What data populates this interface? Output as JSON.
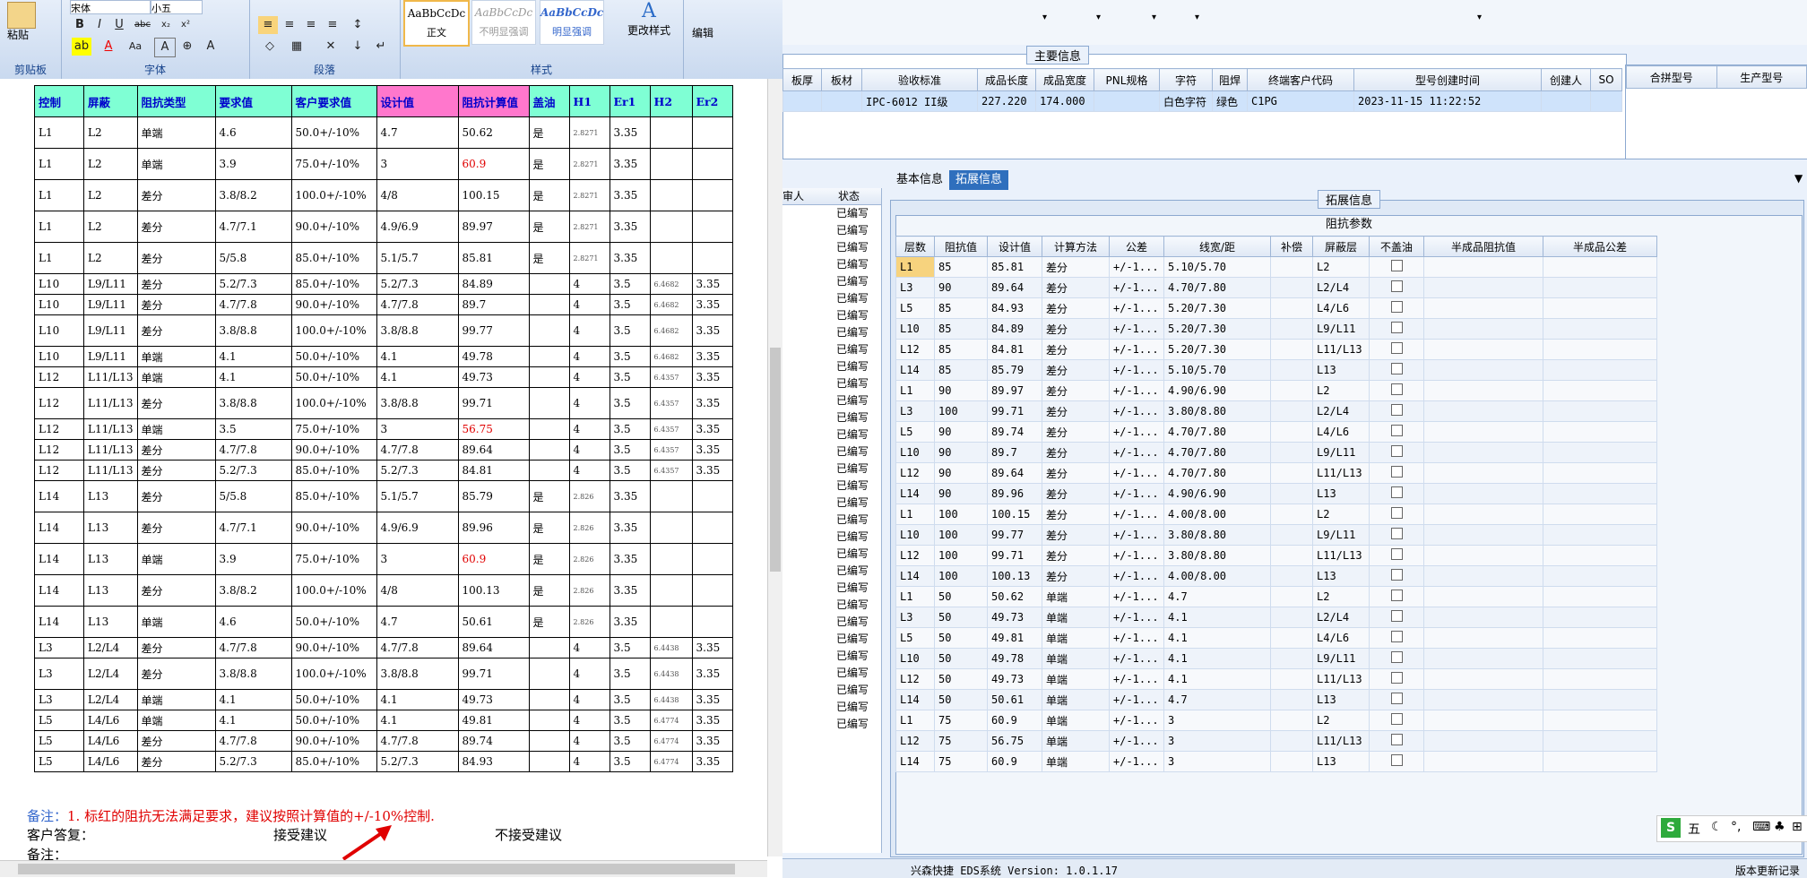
{
  "word": {
    "ribbon": {
      "clipboard": {
        "label": "剪贴板",
        "paste": "粘贴"
      },
      "font": {
        "label": "字体",
        "family": "宋体",
        "size": "小五"
      },
      "paragraph": {
        "label": "段落"
      },
      "styles": {
        "label": "样式",
        "items": [
          "AaBbCcDc",
          "AaBbCcDc",
          "AaBbCcDc"
        ],
        "names": [
          "正文",
          "不明显强调",
          "明显强调"
        ],
        "change": "更改样式"
      },
      "editing": {
        "label": "编辑"
      }
    },
    "table": {
      "headers": [
        "控制",
        "屏蔽",
        "阻抗类型",
        "要求值",
        "客户要求值",
        "设计值",
        "阻抗计算值",
        "盖油",
        "H1",
        "Er1",
        "H2",
        "Er2"
      ],
      "rows": [
        {
          "c": [
            "L1",
            "L2",
            "单端",
            "4.6",
            "50.0+/-10%",
            "4.7",
            "50.62",
            "是",
            "2.8271",
            "3.35",
            "",
            ""
          ],
          "red": false,
          "tall": true
        },
        {
          "c": [
            "L1",
            "L2",
            "单端",
            "3.9",
            "75.0+/-10%",
            "3",
            "60.9",
            "是",
            "2.8271",
            "3.35",
            "",
            ""
          ],
          "red": true,
          "tall": true
        },
        {
          "c": [
            "L1",
            "L2",
            "差分",
            "3.8/8.2",
            "100.0+/-10%",
            "4/8",
            "100.15",
            "是",
            "2.8271",
            "3.35",
            "",
            ""
          ],
          "red": false,
          "tall": true
        },
        {
          "c": [
            "L1",
            "L2",
            "差分",
            "4.7/7.1",
            "90.0+/-10%",
            "4.9/6.9",
            "89.97",
            "是",
            "2.8271",
            "3.35",
            "",
            ""
          ],
          "red": false,
          "tall": true
        },
        {
          "c": [
            "L1",
            "L2",
            "差分",
            "5/5.8",
            "85.0+/-10%",
            "5.1/5.7",
            "85.81",
            "是",
            "2.8271",
            "3.35",
            "",
            ""
          ],
          "red": false,
          "tall": true
        },
        {
          "c": [
            "L10",
            "L9/L11",
            "差分",
            "5.2/7.3",
            "85.0+/-10%",
            "5.2/7.3",
            "84.89",
            "",
            "4",
            "3.5",
            "6.4682",
            "3.35"
          ],
          "red": false,
          "tall": false
        },
        {
          "c": [
            "L10",
            "L9/L11",
            "差分",
            "4.7/7.8",
            "90.0+/-10%",
            "4.7/7.8",
            "89.7",
            "",
            "4",
            "3.5",
            "6.4682",
            "3.35"
          ],
          "red": false,
          "tall": false
        },
        {
          "c": [
            "L10",
            "L9/L11",
            "差分",
            "3.8/8.8",
            "100.0+/-10%",
            "3.8/8.8",
            "99.77",
            "",
            "4",
            "3.5",
            "6.4682",
            "3.35"
          ],
          "red": false,
          "tall": true
        },
        {
          "c": [
            "L10",
            "L9/L11",
            "单端",
            "4.1",
            "50.0+/-10%",
            "4.1",
            "49.78",
            "",
            "4",
            "3.5",
            "6.4682",
            "3.35"
          ],
          "red": false,
          "tall": false
        },
        {
          "c": [
            "L12",
            "L11/L13",
            "单端",
            "4.1",
            "50.0+/-10%",
            "4.1",
            "49.73",
            "",
            "4",
            "3.5",
            "6.4357",
            "3.35"
          ],
          "red": false,
          "tall": false
        },
        {
          "c": [
            "L12",
            "L11/L13",
            "差分",
            "3.8/8.8",
            "100.0+/-10%",
            "3.8/8.8",
            "99.71",
            "",
            "4",
            "3.5",
            "6.4357",
            "3.35"
          ],
          "red": false,
          "tall": true
        },
        {
          "c": [
            "L12",
            "L11/L13",
            "单端",
            "3.5",
            "75.0+/-10%",
            "3",
            "56.75",
            "",
            "4",
            "3.5",
            "6.4357",
            "3.35"
          ],
          "red": true,
          "tall": false
        },
        {
          "c": [
            "L12",
            "L11/L13",
            "差分",
            "4.7/7.8",
            "90.0+/-10%",
            "4.7/7.8",
            "89.64",
            "",
            "4",
            "3.5",
            "6.4357",
            "3.35"
          ],
          "red": false,
          "tall": false
        },
        {
          "c": [
            "L12",
            "L11/L13",
            "差分",
            "5.2/7.3",
            "85.0+/-10%",
            "5.2/7.3",
            "84.81",
            "",
            "4",
            "3.5",
            "6.4357",
            "3.35"
          ],
          "red": false,
          "tall": false
        },
        {
          "c": [
            "L14",
            "L13",
            "差分",
            "5/5.8",
            "85.0+/-10%",
            "5.1/5.7",
            "85.79",
            "是",
            "2.826",
            "3.35",
            "",
            ""
          ],
          "red": false,
          "tall": true
        },
        {
          "c": [
            "L14",
            "L13",
            "差分",
            "4.7/7.1",
            "90.0+/-10%",
            "4.9/6.9",
            "89.96",
            "是",
            "2.826",
            "3.35",
            "",
            ""
          ],
          "red": false,
          "tall": true
        },
        {
          "c": [
            "L14",
            "L13",
            "单端",
            "3.9",
            "75.0+/-10%",
            "3",
            "60.9",
            "是",
            "2.826",
            "3.35",
            "",
            ""
          ],
          "red": true,
          "tall": true
        },
        {
          "c": [
            "L14",
            "L13",
            "差分",
            "3.8/8.2",
            "100.0+/-10%",
            "4/8",
            "100.13",
            "是",
            "2.826",
            "3.35",
            "",
            ""
          ],
          "red": false,
          "tall": true
        },
        {
          "c": [
            "L14",
            "L13",
            "单端",
            "4.6",
            "50.0+/-10%",
            "4.7",
            "50.61",
            "是",
            "2.826",
            "3.35",
            "",
            ""
          ],
          "red": false,
          "tall": true
        },
        {
          "c": [
            "L3",
            "L2/L4",
            "差分",
            "4.7/7.8",
            "90.0+/-10%",
            "4.7/7.8",
            "89.64",
            "",
            "4",
            "3.5",
            "6.4438",
            "3.35"
          ],
          "red": false,
          "tall": false
        },
        {
          "c": [
            "L3",
            "L2/L4",
            "差分",
            "3.8/8.8",
            "100.0+/-10%",
            "3.8/8.8",
            "99.71",
            "",
            "4",
            "3.5",
            "6.4438",
            "3.35"
          ],
          "red": false,
          "tall": true
        },
        {
          "c": [
            "L3",
            "L2/L4",
            "单端",
            "4.1",
            "50.0+/-10%",
            "4.1",
            "49.73",
            "",
            "4",
            "3.5",
            "6.4438",
            "3.35"
          ],
          "red": false,
          "tall": false
        },
        {
          "c": [
            "L5",
            "L4/L6",
            "单端",
            "4.1",
            "50.0+/-10%",
            "4.1",
            "49.81",
            "",
            "4",
            "3.5",
            "6.4774",
            "3.35"
          ],
          "red": false,
          "tall": false
        },
        {
          "c": [
            "L5",
            "L4/L6",
            "差分",
            "4.7/7.8",
            "90.0+/-10%",
            "4.7/7.8",
            "89.74",
            "",
            "4",
            "3.5",
            "6.4774",
            "3.35"
          ],
          "red": false,
          "tall": false
        },
        {
          "c": [
            "L5",
            "L4/L6",
            "差分",
            "5.2/7.3",
            "85.0+/-10%",
            "5.2/7.3",
            "84.93",
            "",
            "4",
            "3.5",
            "6.4774",
            "3.35"
          ],
          "red": false,
          "tall": false
        }
      ]
    },
    "notes": {
      "remark_label": "备注：",
      "remark_text": "1. 标红的阻抗无法满足要求，建议按照计算值的+/-10%控制.",
      "reply_label": "客户答复：",
      "accept": "接受建议",
      "reject": "不接受建议",
      "remark2": "备注："
    }
  },
  "erp": {
    "main_info": {
      "title": "主要信息",
      "headers": [
        "板厚",
        "板材",
        "验收标准",
        "成品长度",
        "成品宽度",
        "PNL规格",
        "字符",
        "阻焊",
        "终端客户代码",
        "型号创建时间",
        "创建人",
        "SO"
      ],
      "row": [
        "",
        "",
        "IPC-6012 II级",
        "227.220",
        "174.000",
        "",
        "白色字符",
        "绿色",
        "C1PG",
        "2023-11-15 11:22:52",
        "",
        ""
      ],
      "side_headers": [
        "合拼型号",
        "生产型号"
      ]
    },
    "tabs": [
      "基本信息",
      "拓展信息"
    ],
    "active_tab": "拓展信息",
    "status_list": {
      "headers": [
        "审人",
        "状态"
      ],
      "item": "已编写",
      "count": 31
    },
    "ext_info": {
      "title": "拓展信息",
      "group": "阻抗参数",
      "headers": [
        "层数",
        "阻抗值",
        "设计值",
        "计算方法",
        "公差",
        "线宽/距",
        "补偿",
        "屏蔽层",
        "不盖油",
        "半成品阻抗值",
        "半成品公差"
      ],
      "rows": [
        [
          "L1",
          "85",
          "85.81",
          "差分",
          "+/-1...",
          "5.10/5.70",
          "",
          "L2"
        ],
        [
          "L3",
          "90",
          "89.64",
          "差分",
          "+/-1...",
          "4.70/7.80",
          "",
          "L2/L4"
        ],
        [
          "L5",
          "85",
          "84.93",
          "差分",
          "+/-1...",
          "5.20/7.30",
          "",
          "L4/L6"
        ],
        [
          "L10",
          "85",
          "84.89",
          "差分",
          "+/-1...",
          "5.20/7.30",
          "",
          "L9/L11"
        ],
        [
          "L12",
          "85",
          "84.81",
          "差分",
          "+/-1...",
          "5.20/7.30",
          "",
          "L11/L13"
        ],
        [
          "L14",
          "85",
          "85.79",
          "差分",
          "+/-1...",
          "5.10/5.70",
          "",
          "L13"
        ],
        [
          "L1",
          "90",
          "89.97",
          "差分",
          "+/-1...",
          "4.90/6.90",
          "",
          "L2"
        ],
        [
          "L3",
          "100",
          "99.71",
          "差分",
          "+/-1...",
          "3.80/8.80",
          "",
          "L2/L4"
        ],
        [
          "L5",
          "90",
          "89.74",
          "差分",
          "+/-1...",
          "4.70/7.80",
          "",
          "L4/L6"
        ],
        [
          "L10",
          "90",
          "89.7",
          "差分",
          "+/-1...",
          "4.70/7.80",
          "",
          "L9/L11"
        ],
        [
          "L12",
          "90",
          "89.64",
          "差分",
          "+/-1...",
          "4.70/7.80",
          "",
          "L11/L13"
        ],
        [
          "L14",
          "90",
          "89.96",
          "差分",
          "+/-1...",
          "4.90/6.90",
          "",
          "L13"
        ],
        [
          "L1",
          "100",
          "100.15",
          "差分",
          "+/-1...",
          "4.00/8.00",
          "",
          "L2"
        ],
        [
          "L10",
          "100",
          "99.77",
          "差分",
          "+/-1...",
          "3.80/8.80",
          "",
          "L9/L11"
        ],
        [
          "L12",
          "100",
          "99.71",
          "差分",
          "+/-1...",
          "3.80/8.80",
          "",
          "L11/L13"
        ],
        [
          "L14",
          "100",
          "100.13",
          "差分",
          "+/-1...",
          "4.00/8.00",
          "",
          "L13"
        ],
        [
          "L1",
          "50",
          "50.62",
          "单端",
          "+/-1...",
          "4.7",
          "",
          "L2"
        ],
        [
          "L3",
          "50",
          "49.73",
          "单端",
          "+/-1...",
          "4.1",
          "",
          "L2/L4"
        ],
        [
          "L5",
          "50",
          "49.81",
          "单端",
          "+/-1...",
          "4.1",
          "",
          "L4/L6"
        ],
        [
          "L10",
          "50",
          "49.78",
          "单端",
          "+/-1...",
          "4.1",
          "",
          "L9/L11"
        ],
        [
          "L12",
          "50",
          "49.73",
          "单端",
          "+/-1...",
          "4.1",
          "",
          "L11/L13"
        ],
        [
          "L14",
          "50",
          "50.61",
          "单端",
          "+/-1...",
          "4.7",
          "",
          "L13"
        ],
        [
          "L1",
          "75",
          "60.9",
          "单端",
          "+/-1...",
          "3",
          "",
          "L2"
        ],
        [
          "L12",
          "75",
          "56.75",
          "单端",
          "+/-1...",
          "3",
          "",
          "L11/L13"
        ],
        [
          "L14",
          "75",
          "60.9",
          "单端",
          "+/-1...",
          "3",
          "",
          "L13"
        ]
      ]
    },
    "footer": {
      "left": "兴森快捷 EDS系统 Version: 1.0.1.17",
      "right": "版本更新记录"
    },
    "ime": {
      "label": "五"
    }
  },
  "colors": {
    "header_cyan": "#7fffd4",
    "header_pink": "#ff77cc",
    "red": "#e00000",
    "tab_active": "#2f6fbd",
    "selected_row": "#cfe3fb"
  }
}
